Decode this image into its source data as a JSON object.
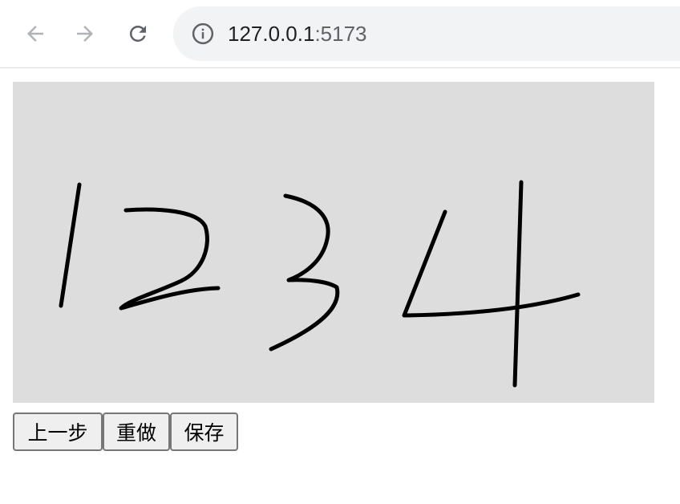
{
  "browser": {
    "url_host": "127.0.0.1",
    "url_port": ":5173",
    "icons": [
      "back-arrow-icon",
      "forward-arrow-icon",
      "reload-icon",
      "site-info-icon"
    ]
  },
  "canvas": {
    "background": "#dddddd",
    "stroke_color": "#000000",
    "drawn_content": "1234"
  },
  "buttons": {
    "undo": "上一步",
    "redo": "重做",
    "save": "保存"
  }
}
